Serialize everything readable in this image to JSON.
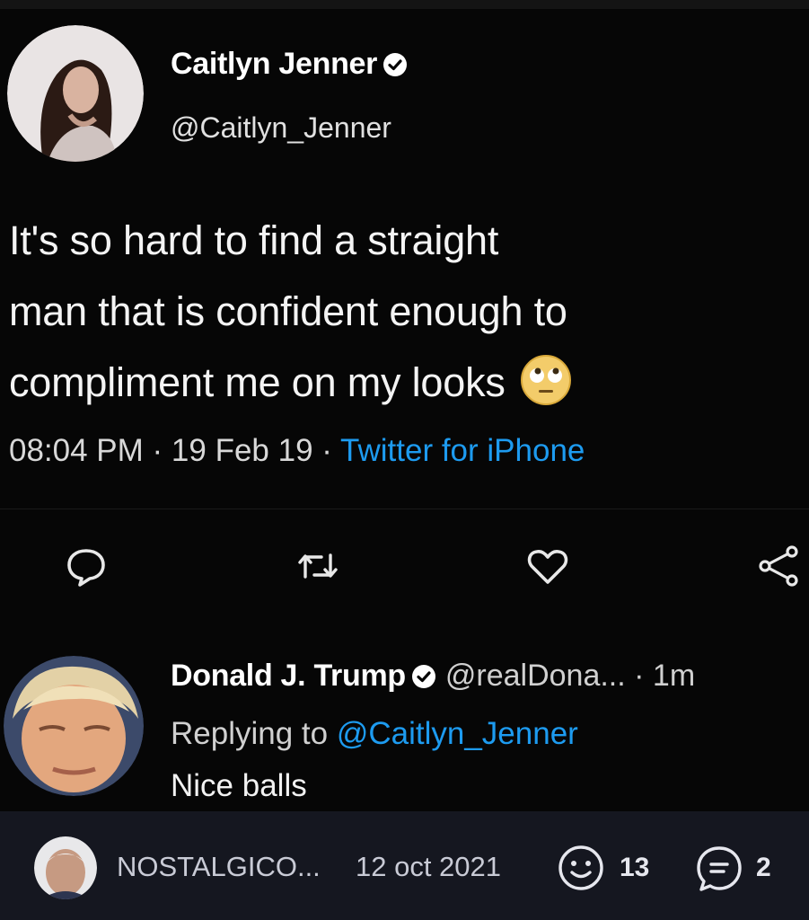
{
  "colors": {
    "background": "#000000",
    "link": "#1d9bf0",
    "footer_bg": "#151720"
  },
  "tweet": {
    "author": {
      "name": "Caitlyn Jenner",
      "handle": "@Caitlyn_Jenner",
      "verified": true
    },
    "text_lines": [
      "It's so hard to find a straight",
      "man that is confident enough to",
      "compliment me on my looks"
    ],
    "emoji": "face-with-rolling-eyes",
    "time": "08:04 PM",
    "sep": " · ",
    "date": "19 Feb 19",
    "source": "Twitter for iPhone",
    "actions": [
      "reply-icon",
      "retweet-icon",
      "like-icon",
      "share-icon"
    ]
  },
  "reply": {
    "author": {
      "name": "Donald J. Trump",
      "handle": "@realDona...",
      "time": "· 1m",
      "verified": true
    },
    "replying_prefix": "Replying to ",
    "replying_to": "@Caitlyn_Jenner",
    "text": "Nice balls"
  },
  "footer": {
    "username": "NOSTALGICO...",
    "date": "12 oct 2021",
    "reactions": "13",
    "comments": "2"
  }
}
